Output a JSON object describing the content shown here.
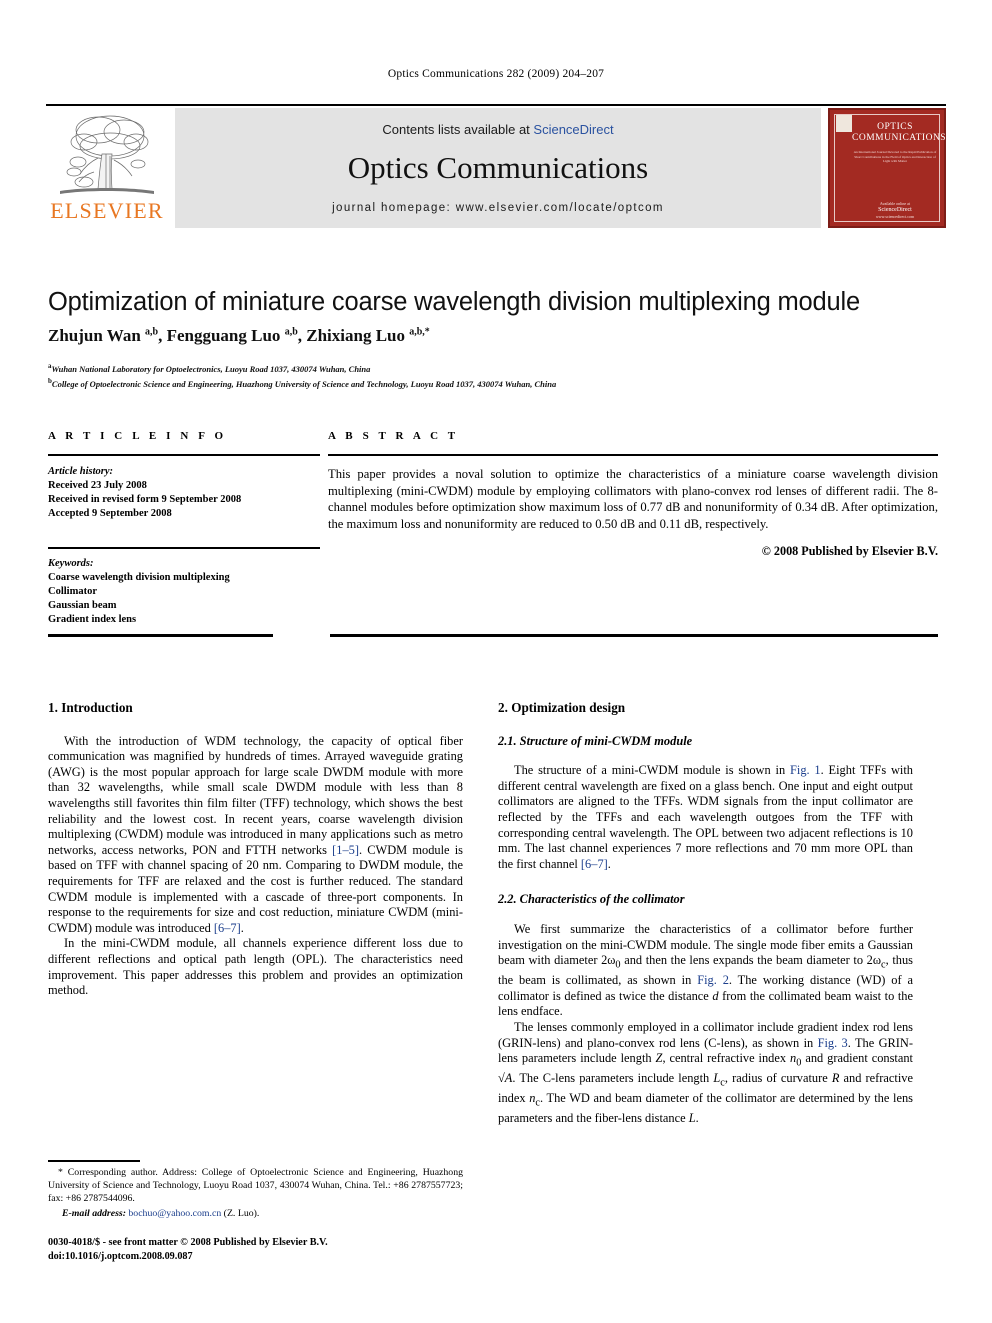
{
  "running_head": "Optics Communications 282 (2009) 204–207",
  "masthead": {
    "publisher_name": "ELSEVIER",
    "contents_prefix": "Contents lists available at ",
    "contents_link": "ScienceDirect",
    "journal_name": "Optics Communications",
    "homepage": "journal homepage: www.elsevier.com/locate/optcom",
    "cover": {
      "title_line1": "OPTICS",
      "title_line2": "COMMUNICATIONS",
      "subtitle": "An International Journal Devoted to the Rapid Publication of Short Contributions in the Field of Optics and Interaction of Light with Matter",
      "foot_label": "Available online at",
      "foot_brand": "ScienceDirect",
      "foot_url": "www.sciencedirect.com",
      "color": "#a32a22"
    }
  },
  "article": {
    "title": "Optimization of miniature coarse wavelength division multiplexing module",
    "authors_html": "Zhujun Wan <sup>a,b</sup>, Fengguang Luo <sup>a,b</sup>, Zhixiang Luo <sup>a,b,*</sup>",
    "affiliation_a": "Wuhan National Laboratory for Optoelectronics, Luoyu Road 1037, 430074 Wuhan, China",
    "affiliation_b": "College of Optoelectronic Science and Engineering, Huazhong University of Science and Technology, Luoyu Road 1037, 430074 Wuhan, China"
  },
  "info": {
    "heading": "A R T I C L E    I N F O",
    "history_heading": "Article history:",
    "history": [
      "Received 23 July 2008",
      "Received in revised form 9 September 2008",
      "Accepted 9 September 2008"
    ],
    "keywords_heading": "Keywords:",
    "keywords": [
      "Coarse wavelength division multiplexing",
      "Collimator",
      "Gaussian beam",
      "Gradient index lens"
    ]
  },
  "abstract": {
    "heading": "A B S T R A C T",
    "text": "This paper provides a noval solution to optimize the characteristics of a miniature coarse wavelength division multiplexing (mini-CWDM) module by employing collimators with plano-convex rod lenses of different radii. The 8-channel modules before optimization show maximum loss of 0.77 dB and nonuniformity of 0.34 dB. After optimization, the maximum loss and nonuniformity are reduced to 0.50 dB and 0.11 dB, respectively.",
    "copyright": "© 2008 Published by Elsevier B.V."
  },
  "sections": {
    "s1_heading": "1. Introduction",
    "s1_p1_a": "With the introduction of WDM technology, the capacity of optical fiber communication was magnified by hundreds of times. Arrayed waveguide grating (AWG) is the most popular approach for large scale DWDM module with more than 32 wavelengths, while small scale DWDM module with less than 8 wavelengths still favorites thin film filter (TFF) technology, which shows the best reliability and the lowest cost. In recent years, coarse wavelength division multiplexing (CWDM) module was introduced in many applications such as metro networks, access networks, PON and FTTH networks ",
    "s1_ref1": "[1–5]",
    "s1_p1_b": ". CWDM module is based on TFF with channel spacing of 20 nm. Comparing to DWDM module, the requirements for TFF are relaxed and the cost is further reduced. The standard CWDM module is implemented with a cascade of three-port components. In response to the requirements for size and cost reduction, miniature CWDM (mini-CWDM) module was introduced ",
    "s1_ref2": "[6–7]",
    "s1_p1_c": ".",
    "s1_p2": "In the mini-CWDM module, all channels experience different loss due to different reflections and optical path length (OPL). The characteristics need improvement. This paper addresses this problem and provides an optimization method.",
    "s2_heading": "2. Optimization design",
    "s21_heading": "2.1. Structure of mini-CWDM module",
    "s21_p_a": "The structure of a mini-CWDM module is shown in ",
    "s21_fig1": "Fig. 1",
    "s21_p_b": ". Eight TFFs with different central wavelength are fixed on a glass bench. One input and eight output collimators are aligned to the TFFs. WDM signals from the input collimator are reflected by the TFFs and each wavelength outgoes from the TFF with corresponding central wavelength. The OPL between two adjacent reflections is 10 mm. The last channel experiences 7 more reflections and 70 mm more OPL than the first channel ",
    "s21_ref": "[6–7]",
    "s21_p_c": ".",
    "s22_heading": "2.2. Characteristics of the collimator",
    "s22_p1_a": "We first summarize the characteristics of a collimator before further investigation on the mini-CWDM module. The single mode fiber emits a Gaussian beam with diameter 2ω",
    "s22_sub0": "0",
    "s22_p1_b": " and then the lens expands the beam diameter to 2ω",
    "s22_subc": "c",
    "s22_p1_c": ", thus the beam is collimated, as shown in ",
    "s22_fig2": "Fig. 2",
    "s22_p1_d": ". The working distance (WD) of a collimator is defined as twice the distance ",
    "s22_var_d": "d",
    "s22_p1_e": " from the collimated beam waist to the lens endface.",
    "s22_p2_a": "The lenses commonly employed in a collimator include gradient index rod lens (GRIN-lens) and plano-convex rod lens (C-lens), as shown in ",
    "s22_fig3": "Fig. 3",
    "s22_p2_b": ". The GRIN-lens parameters include length ",
    "s22_var_Z": "Z",
    "s22_p2_c": ", central refractive index ",
    "s22_var_n0": "n",
    "s22_sub_n0": "0",
    "s22_p2_d": " and gradient constant ",
    "s22_var_A": "√A",
    "s22_p2_e": ". The C-lens parameters include length ",
    "s22_var_Lc": "L",
    "s22_sub_Lc": "c",
    "s22_p2_f": ", radius of curvature ",
    "s22_var_R": "R",
    "s22_p2_g": " and refractive index ",
    "s22_var_nc": "n",
    "s22_sub_nc": "c",
    "s22_p2_h": ". The WD and beam diameter of the collimator are determined by the lens parameters and the fiber-lens distance ",
    "s22_var_L": "L",
    "s22_p2_i": "."
  },
  "footnote": {
    "marker": "*",
    "line1": " Corresponding author. Address: College of Optoelectronic Science and Engineering, Huazhong University of Science and Technology, Luoyu Road 1037, 430074 Wuhan, China. Tel.: +86 2787557723; fax: +86 2787544096.",
    "email_label": "E-mail address:",
    "email": "bochuo@yahoo.com.cn",
    "email_attrib": " (Z. Luo)."
  },
  "issn": {
    "line1": "0030-4018/$ - see front matter © 2008 Published by Elsevier B.V.",
    "line2": "doi:10.1016/j.optcom.2008.09.087"
  }
}
